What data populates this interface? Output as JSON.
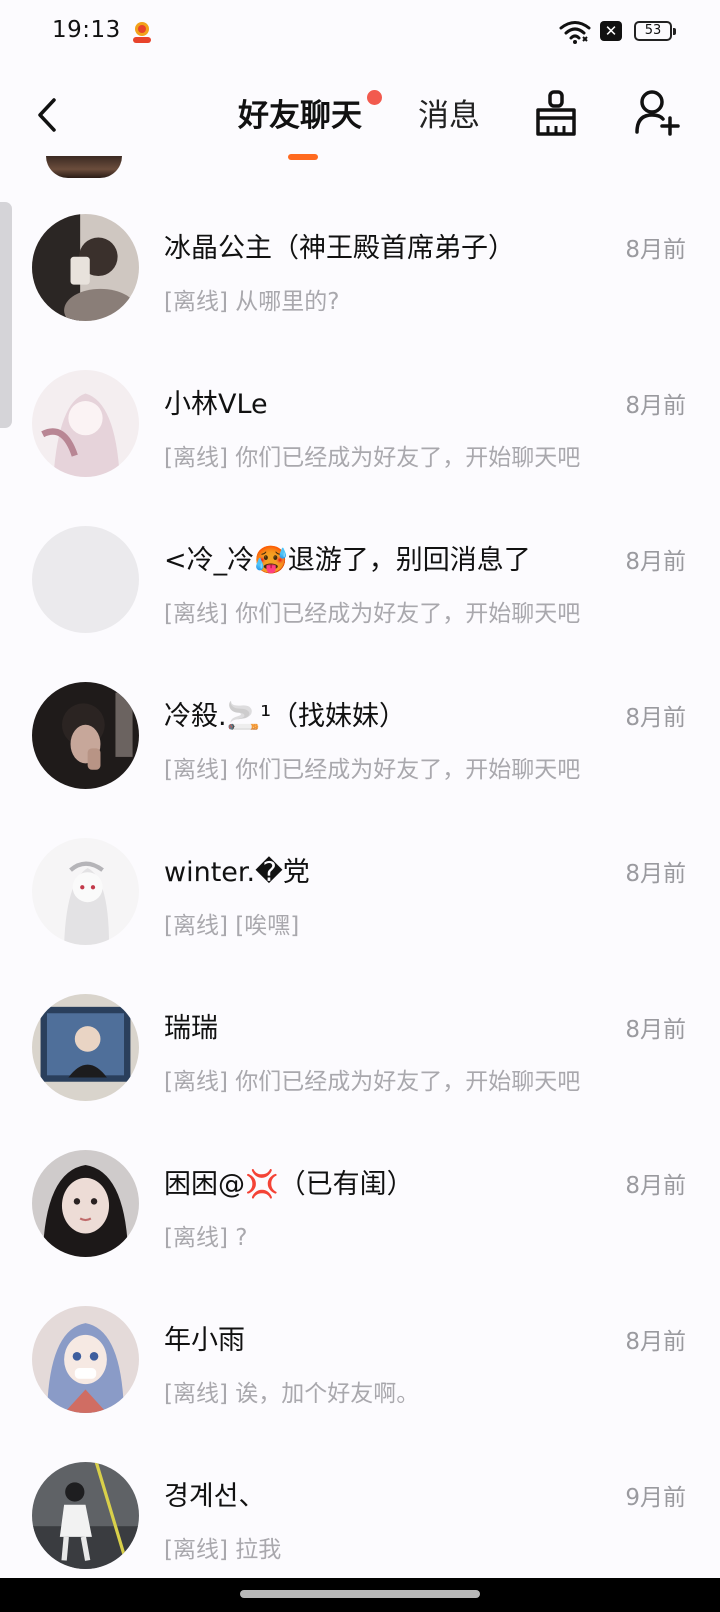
{
  "status_bar": {
    "time": "19:13",
    "battery": "53",
    "icons": [
      "app-notification-icon",
      "wifi-icon",
      "sim-off-icon",
      "battery-icon"
    ]
  },
  "nav": {
    "back_icon": "chevron-left-icon",
    "tabs": [
      {
        "label": "好友聊天",
        "active": true,
        "has_dot": true
      },
      {
        "label": "消息",
        "active": false
      }
    ],
    "clean_icon": "broom-icon",
    "add_friend_icon": "add-user-icon",
    "accent_color": "#ff6a1f",
    "dot_color": "#f25a4e"
  },
  "chats": [
    {
      "name": "冰晶公主（神王殿首席弟子）",
      "preview": "[离线] 从哪里的?",
      "time": "8月前"
    },
    {
      "name": "小林VLe",
      "preview": "[离线] 你们已经成为好友了，开始聊天吧",
      "time": "8月前"
    },
    {
      "name": "<冷_冷🥵退游了，别回消息了",
      "preview": "[离线] 你们已经成为好友了，开始聊天吧",
      "time": "8月前"
    },
    {
      "name": "冷殺.🚬¹（找妹妹）",
      "preview": "[离线] 你们已经成为好友了，开始聊天吧",
      "time": "8月前"
    },
    {
      "name": "winter.�党",
      "preview": "[离线] [唉嘿]",
      "time": "8月前"
    },
    {
      "name": "瑞瑞",
      "preview": "[离线] 你们已经成为好友了，开始聊天吧",
      "time": "8月前"
    },
    {
      "name": "困困@💢（已有闺）",
      "preview": "[离线] ?",
      "time": "8月前"
    },
    {
      "name": "年小雨",
      "preview": "[离线] 诶，加个好友啊。",
      "time": "8月前"
    },
    {
      "name": "경계선、",
      "preview": "[离线] 拉我",
      "time": "9月前"
    }
  ]
}
